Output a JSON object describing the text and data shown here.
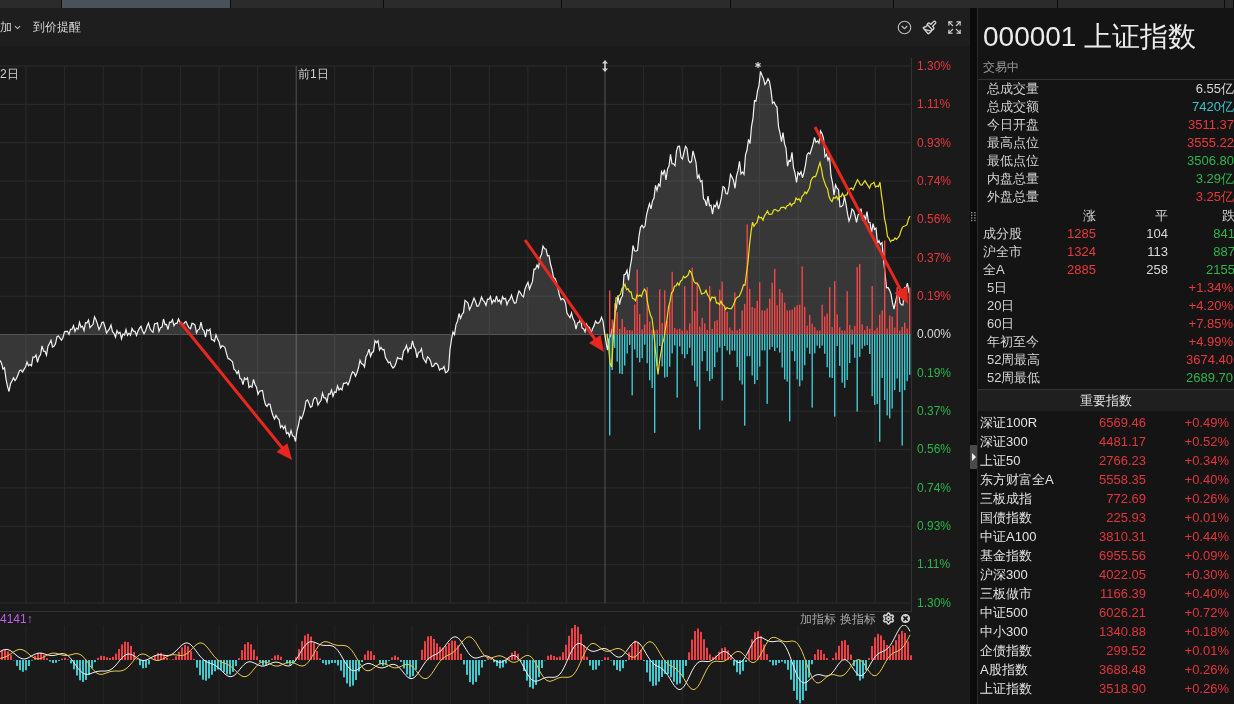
{
  "tabs": [
    {
      "selected": false
    },
    {
      "selected": true
    },
    {
      "selected": false
    },
    {
      "selected": false
    },
    {
      "selected": false
    },
    {
      "selected": false
    },
    {
      "selected": false
    },
    {
      "selected": false
    },
    {
      "selected": false
    }
  ],
  "toolbar": {
    "overlay": "加",
    "price_alert": "到价提醒"
  },
  "chart": {
    "day_labels": [
      "2日",
      "前1日"
    ],
    "y_axis": [
      {
        "label": "1.30%",
        "color": "#e8383d"
      },
      {
        "label": "1.11%",
        "color": "#e8383d"
      },
      {
        "label": "0.93%",
        "color": "#e8383d"
      },
      {
        "label": "0.74%",
        "color": "#e8383d"
      },
      {
        "label": "0.56%",
        "color": "#e8383d"
      },
      {
        "label": "0.37%",
        "color": "#e8383d"
      },
      {
        "label": "0.19%",
        "color": "#e8383d"
      },
      {
        "label": "0.00%",
        "color": "#d8d8d8"
      },
      {
        "label": "0.19%",
        "color": "#2eb54a"
      },
      {
        "label": "0.37%",
        "color": "#2eb54a"
      },
      {
        "label": "0.56%",
        "color": "#2eb54a"
      },
      {
        "label": "0.74%",
        "color": "#2eb54a"
      },
      {
        "label": "0.93%",
        "color": "#2eb54a"
      },
      {
        "label": "1.11%",
        "color": "#2eb54a"
      },
      {
        "label": "1.30%",
        "color": "#2eb54a"
      }
    ]
  },
  "indicator": {
    "reading": "4141↑",
    "buttons": [
      "加指标",
      "换指标"
    ]
  },
  "quote": {
    "title": "000001 上证指数",
    "status": "交易中",
    "stats": [
      {
        "label": "总成交量",
        "value": "6.55亿",
        "color": "#d8d8d8"
      },
      {
        "label": "总成交额",
        "value": "7420亿",
        "color": "#3fc1c9"
      },
      {
        "label": "今日开盘",
        "value": "3511.37",
        "color": "#e8383d"
      },
      {
        "label": "最高点位",
        "value": "3555.22",
        "color": "#e8383d"
      },
      {
        "label": "最低点位",
        "value": "3506.80",
        "color": "#2eb54a"
      },
      {
        "label": "内盘总量",
        "value": "3.29亿",
        "color": "#2eb54a"
      },
      {
        "label": "外盘总量",
        "value": "3.25亿",
        "color": "#e8383d"
      }
    ],
    "breadth_header": [
      "涨",
      "平",
      "跌"
    ],
    "breadth": [
      {
        "label": "成分股",
        "up": "1285",
        "flat": "104",
        "down": "841"
      },
      {
        "label": "沪全市",
        "up": "1324",
        "flat": "113",
        "down": "887"
      },
      {
        "label": "全A",
        "up": "2885",
        "flat": "258",
        "down": "2155"
      }
    ],
    "returns": [
      {
        "label": "5日",
        "value": "+1.34%",
        "color": "#e8383d"
      },
      {
        "label": "20日",
        "value": "+4.20%",
        "color": "#e8383d"
      },
      {
        "label": "60日",
        "value": "+7.85%",
        "color": "#e8383d"
      },
      {
        "label": "年初至今",
        "value": "+4.99%",
        "color": "#e8383d"
      },
      {
        "label": "52周最高",
        "value": "3674.40",
        "color": "#e8383d"
      },
      {
        "label": "52周最低",
        "value": "2689.70",
        "color": "#2eb54a"
      }
    ]
  },
  "indices": {
    "title": "重要指数",
    "rows": [
      {
        "name": "深证100R",
        "value": "6569.46",
        "change": "+0.49%"
      },
      {
        "name": "深证300",
        "value": "4481.17",
        "change": "+0.52%"
      },
      {
        "name": "上证50",
        "value": "2766.23",
        "change": "+0.34%"
      },
      {
        "name": "东方财富全A",
        "value": "5558.35",
        "change": "+0.40%"
      },
      {
        "name": "三板成指",
        "value": "772.69",
        "change": "+0.26%"
      },
      {
        "name": "国债指数",
        "value": "225.93",
        "change": "+0.01%"
      },
      {
        "name": "中证A100",
        "value": "3810.31",
        "change": "+0.44%"
      },
      {
        "name": "基金指数",
        "value": "6955.56",
        "change": "+0.09%"
      },
      {
        "name": "沪深300",
        "value": "4022.05",
        "change": "+0.30%"
      },
      {
        "name": "三板做市",
        "value": "1166.39",
        "change": "+0.40%"
      },
      {
        "name": "中证500",
        "value": "6026.21",
        "change": "+0.72%"
      },
      {
        "name": "中小300",
        "value": "1340.88",
        "change": "+0.18%"
      },
      {
        "name": "企债指数",
        "value": "299.52",
        "change": "+0.01%"
      },
      {
        "name": "A股指数",
        "value": "3688.48",
        "change": "+0.26%"
      },
      {
        "name": "上证指数",
        "value": "3518.90",
        "change": "+0.26%"
      }
    ]
  }
}
